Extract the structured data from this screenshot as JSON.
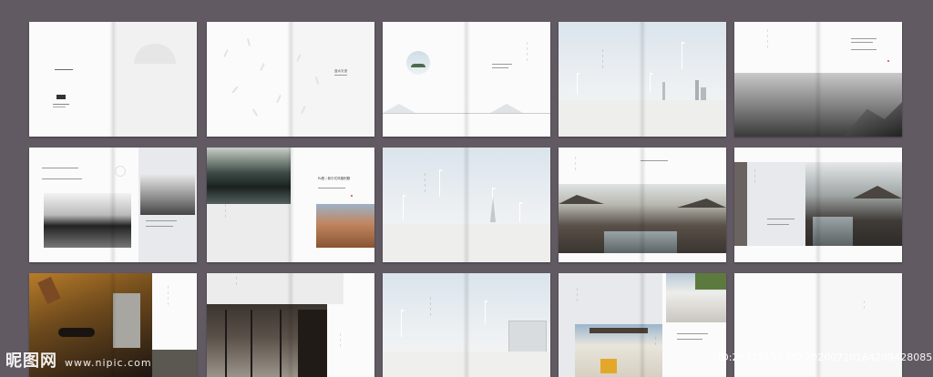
{
  "watermark": {
    "logo": "昵图网",
    "url": "www.nipic.com"
  },
  "image_id": "ID:25315159 NO:20200710164209428085",
  "spread_2": {
    "title": "蓝水天漫"
  },
  "spread_12": {
    "caption_line": "Ri更 / 新中式风格别墅"
  },
  "colors": {
    "background": "#625a63",
    "page": "#fbfbfb",
    "panel": "#e7e9ec",
    "accent": "#c64a3a"
  }
}
